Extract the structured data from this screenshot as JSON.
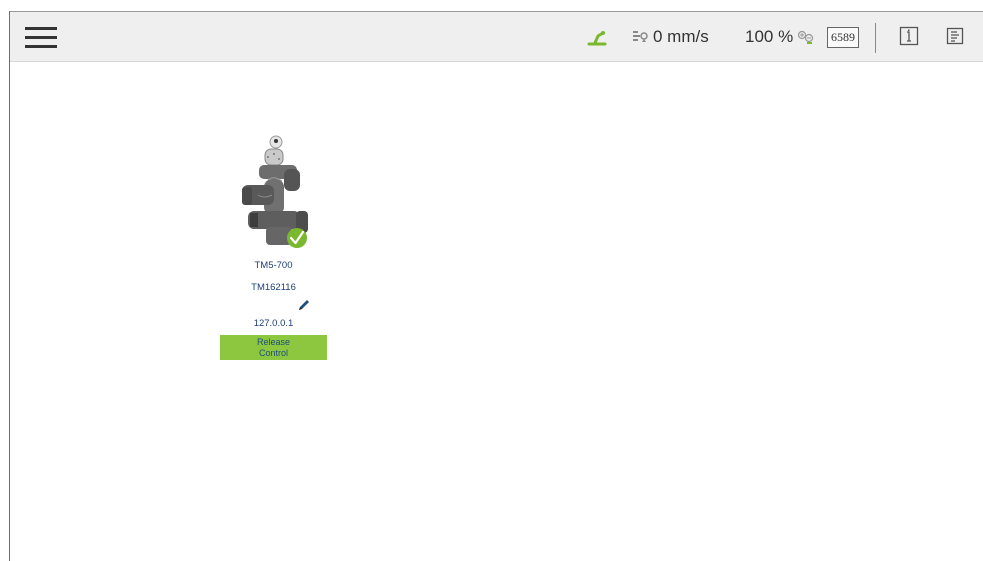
{
  "header": {
    "speed": "0 mm/s",
    "speed_percent": "100 %",
    "counter": "6589",
    "icons": [
      "menu-icon",
      "robot-status-icon",
      "speed-icon",
      "speed-adjust-icon",
      "info-icon",
      "log-icon"
    ],
    "accent_color": "#7ab82f"
  },
  "robot": {
    "model": "TM5-700",
    "serial": "TM162116",
    "ip": "127.0.0.1",
    "release_label": "Release Control",
    "status": "connected",
    "button_color": "#8dc63f"
  }
}
